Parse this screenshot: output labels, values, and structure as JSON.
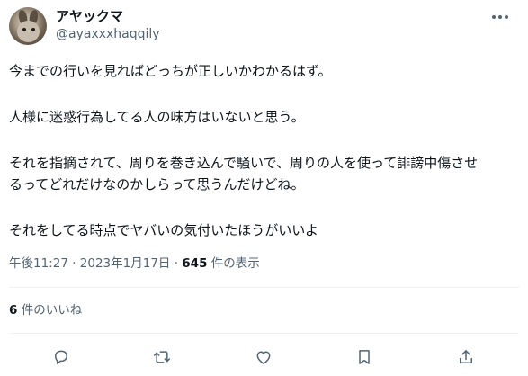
{
  "author": {
    "display_name": "アヤックマ",
    "handle": "@ayaxxxhaqqily"
  },
  "tweet": {
    "lines": [
      "今までの行いを見ればどっちが正しいかわかるはず。",
      "人様に迷惑行為してる人の味方はいないと思う。",
      "それを指摘されて、周りを巻き込んで騒いで、周りの人を使って誹謗中傷させ",
      "るってどれだけなのかしらって思うんだけどね。",
      "それをしてる時点でヤバいの気付いたほうがいいよ"
    ]
  },
  "meta": {
    "timestamp": "午後11:27 · 2023年1月17日 · ",
    "views_count": "645",
    "views_label": " 件の表示"
  },
  "likes": {
    "count": "6",
    "label": " 件のいいね"
  },
  "icons": {
    "more": "more-horizontal-icon",
    "reply": "reply-icon",
    "retweet": "retweet-icon",
    "like": "heart-icon",
    "bookmark": "bookmark-icon",
    "share": "share-icon"
  },
  "colors": {
    "text": "#0f1419",
    "secondary": "#536471",
    "divider": "#eff3f4"
  }
}
